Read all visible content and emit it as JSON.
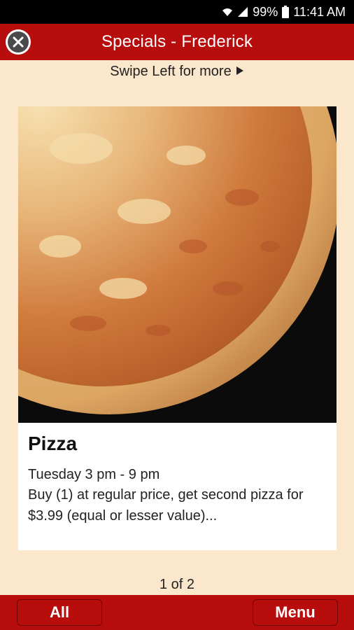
{
  "status_bar": {
    "battery": "99%",
    "time": "11:41 AM",
    "icons": [
      "wifi-icon",
      "signal-icon",
      "battery-icon"
    ]
  },
  "header": {
    "title": "Specials - Frederick",
    "close_icon": "close-icon"
  },
  "swipe_hint": {
    "label": "Swipe Left for more",
    "icon": "play-arrow-icon"
  },
  "special": {
    "title": "Pizza",
    "time": "Tuesday 3 pm - 9 pm",
    "description": "Buy (1) at regular price, get second pizza for $3.99 (equal or lesser value)...",
    "image": "cheese-pizza-photo"
  },
  "pager": {
    "label": "1 of 2"
  },
  "bottom_bar": {
    "all_label": "All",
    "menu_label": "Menu"
  },
  "colors": {
    "brand_red": "#b80d0d",
    "background": "#fbe7cb"
  }
}
